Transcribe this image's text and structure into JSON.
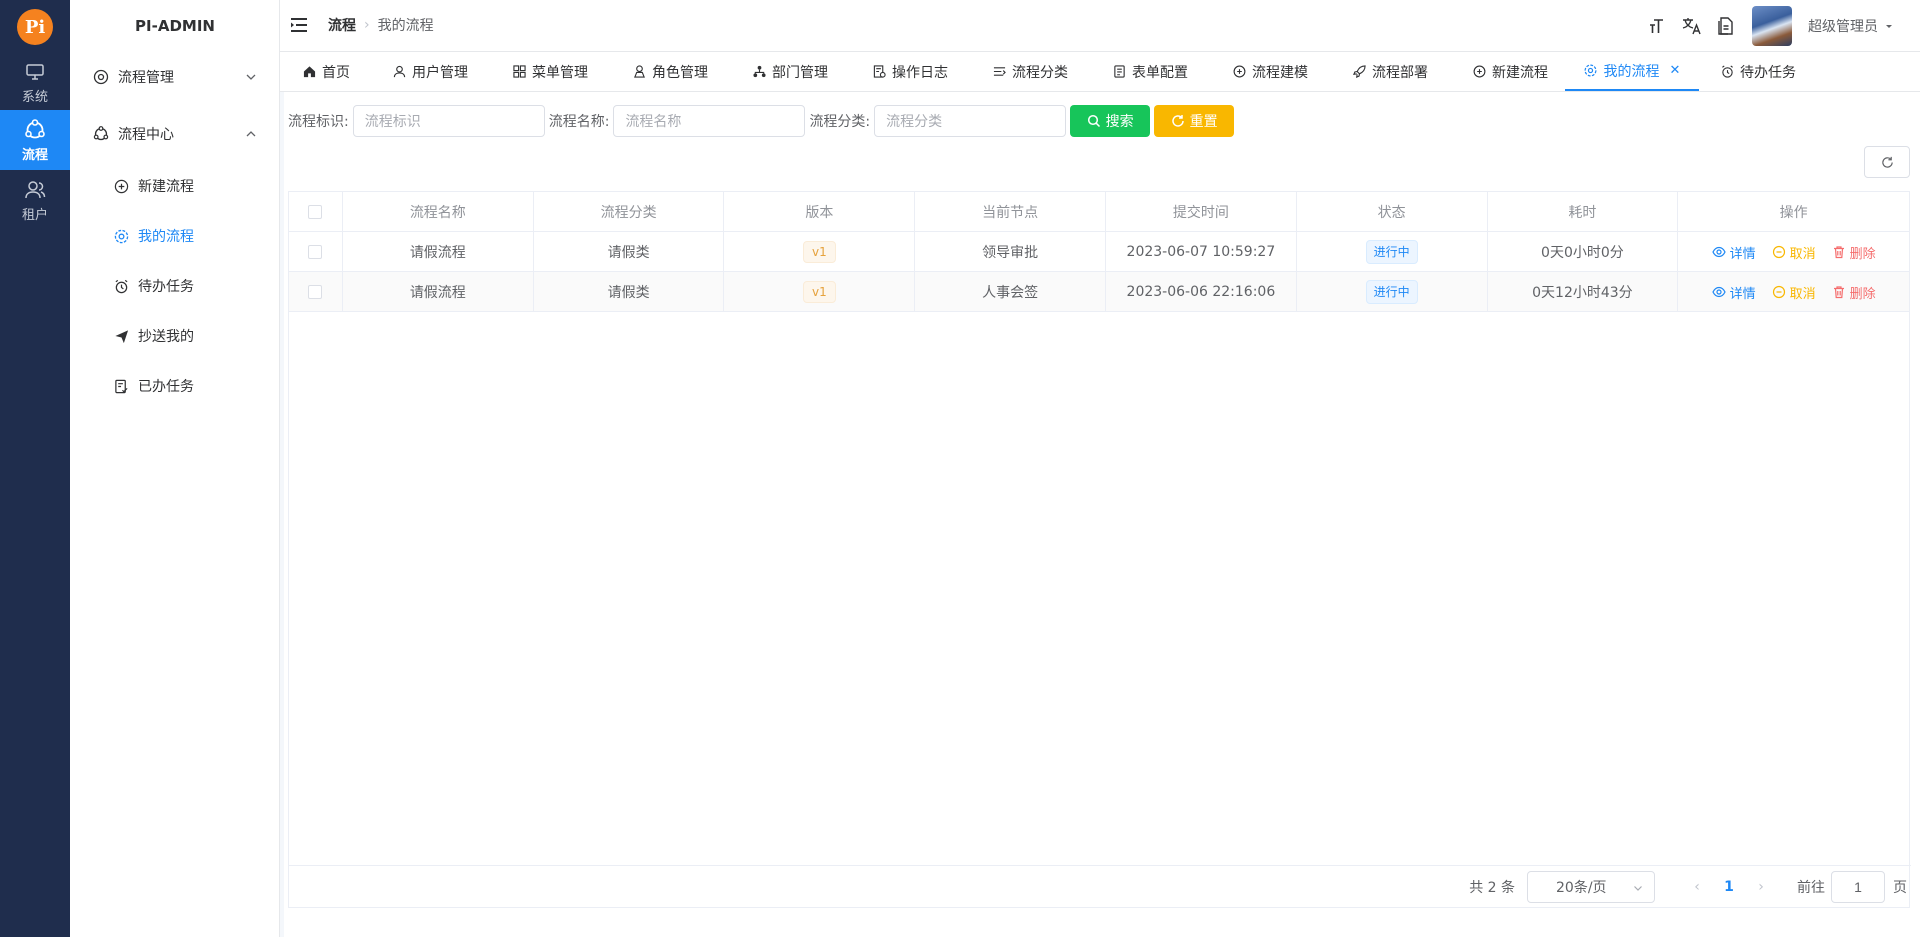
{
  "app": {
    "logo_text": "Pi",
    "title": "PI-ADMIN"
  },
  "rail": [
    {
      "label": "系统",
      "icon": "monitor-icon"
    },
    {
      "label": "流程",
      "icon": "flow-icon",
      "active": true
    },
    {
      "label": "租户",
      "icon": "users-icon"
    }
  ],
  "menu": {
    "groups": [
      {
        "label": "流程管理",
        "expanded": false
      },
      {
        "label": "流程中心",
        "expanded": true
      }
    ],
    "items": [
      {
        "label": "新建流程",
        "icon": "plus-circle-icon"
      },
      {
        "label": "我的流程",
        "icon": "settings-circle-icon",
        "active": true
      },
      {
        "label": "待办任务",
        "icon": "alarm-clock-icon"
      },
      {
        "label": "抄送我的",
        "icon": "paper-plane-icon"
      },
      {
        "label": "已办任务",
        "icon": "document-check-icon"
      }
    ]
  },
  "header": {
    "breadcrumb": [
      "流程",
      "我的流程"
    ],
    "user_name": "超级管理员"
  },
  "tabs": [
    {
      "label": "首页",
      "icon": "home-icon"
    },
    {
      "label": "用户管理",
      "icon": "user-icon"
    },
    {
      "label": "菜单管理",
      "icon": "grid-icon"
    },
    {
      "label": "角色管理",
      "icon": "role-icon"
    },
    {
      "label": "部门管理",
      "icon": "org-icon"
    },
    {
      "label": "操作日志",
      "icon": "log-icon"
    },
    {
      "label": "流程分类",
      "icon": "list-icon"
    },
    {
      "label": "表单配置",
      "icon": "form-icon"
    },
    {
      "label": "流程建模",
      "icon": "plus-circle-icon"
    },
    {
      "label": "流程部署",
      "icon": "rocket-icon"
    },
    {
      "label": "新建流程",
      "icon": "plus-circle-icon"
    },
    {
      "label": "我的流程",
      "icon": "settings-circle-icon",
      "active": true,
      "closable": true
    },
    {
      "label": "待办任务",
      "icon": "alarm-clock-icon"
    }
  ],
  "search": {
    "key_label": "流程标识:",
    "key_placeholder": "流程标识",
    "name_label": "流程名称:",
    "name_placeholder": "流程名称",
    "category_label": "流程分类:",
    "category_placeholder": "流程分类",
    "search_button": "搜索",
    "reset_button": "重置"
  },
  "table": {
    "columns": [
      "流程名称",
      "流程分类",
      "版本",
      "当前节点",
      "提交时间",
      "状态",
      "耗时",
      "操作"
    ],
    "rows": [
      {
        "name": "请假流程",
        "category": "请假类",
        "version": "v1",
        "node": "领导审批",
        "submit_time": "2023-06-07 10:59:27",
        "status": "进行中",
        "duration": "0天0小时0分"
      },
      {
        "name": "请假流程",
        "category": "请假类",
        "version": "v1",
        "node": "人事会签",
        "submit_time": "2023-06-06 22:16:06",
        "status": "进行中",
        "duration": "0天12小时43分"
      }
    ],
    "actions": {
      "view": "详情",
      "cancel": "取消",
      "delete": "删除"
    }
  },
  "pagination": {
    "total_text": "共 2 条",
    "page_size": "20条/页",
    "current_page": "1",
    "goto_label": "前往",
    "goto_value": "1",
    "page_suffix": "页"
  },
  "colors": {
    "rail_bg": "#1f2d4d",
    "accent": "#1e88f5",
    "search_btn": "#17c55a",
    "reset_btn": "#f9b700",
    "delete": "#f56c6c"
  }
}
